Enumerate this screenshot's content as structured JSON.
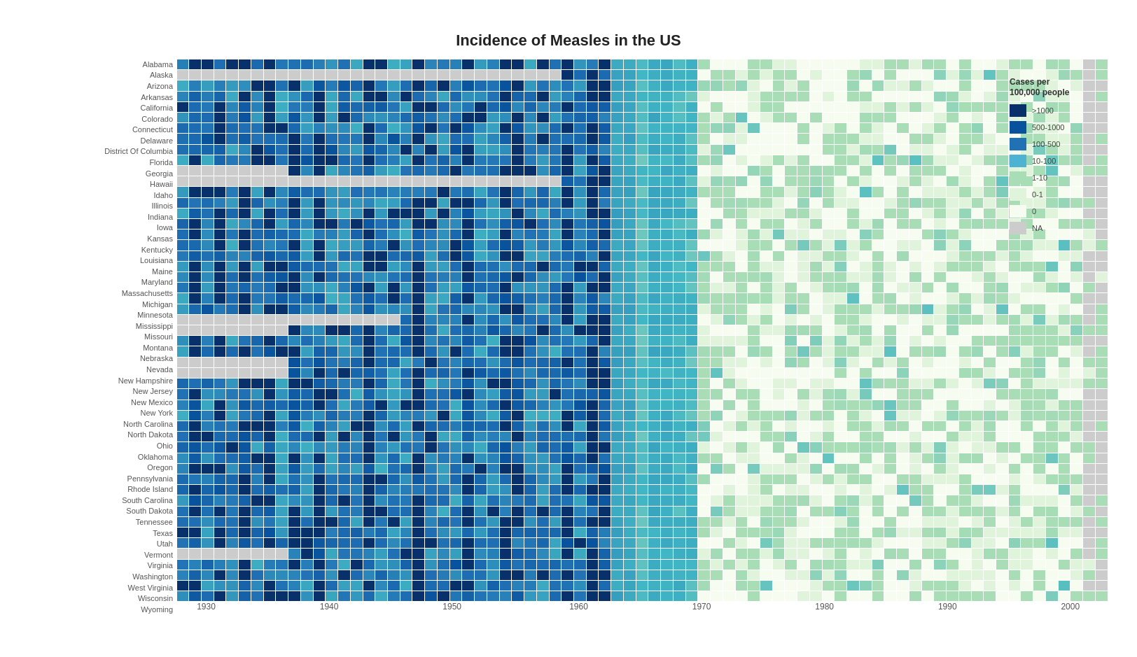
{
  "title": "Incidence of Measles in the US",
  "legend": {
    "title": "Cases per\n100,000 people",
    "items": [
      {
        "label": ">1000",
        "color": "#08306b"
      },
      {
        "label": "500-1000",
        "color": "#08519c"
      },
      {
        "label": "100-500",
        "color": "#2171b5"
      },
      {
        "label": "10-100",
        "color": "#4eb3d3"
      },
      {
        "label": "1-10",
        "color": "#a8ddb5"
      },
      {
        "label": "0-1",
        "color": "#e0f3db"
      },
      {
        "label": "0",
        "color": "#f7fcf0"
      },
      {
        "label": "NA",
        "color": "#cccccc"
      }
    ]
  },
  "states": [
    "Alabama",
    "Alaska",
    "Arizona",
    "Arkansas",
    "California",
    "Colorado",
    "Connecticut",
    "Delaware",
    "District Of Columbia",
    "Florida",
    "Georgia",
    "Hawaii",
    "Idaho",
    "Illinois",
    "Indiana",
    "Iowa",
    "Kansas",
    "Kentucky",
    "Louisiana",
    "Maine",
    "Maryland",
    "Massachusetts",
    "Michigan",
    "Minnesota",
    "Mississippi",
    "Missouri",
    "Montana",
    "Nebraska",
    "Nevada",
    "New Hampshire",
    "New Jersey",
    "New Mexico",
    "New York",
    "North Carolina",
    "North Dakota",
    "Ohio",
    "Oklahoma",
    "Oregon",
    "Pennsylvania",
    "Rhode Island",
    "South Carolina",
    "South Dakota",
    "Tennessee",
    "Texas",
    "Utah",
    "Vermont",
    "Virginia",
    "Washington",
    "West Virginia",
    "Wisconsin",
    "Wyoming"
  ],
  "years": [
    1928,
    1929,
    1930,
    1931,
    1932,
    1933,
    1934,
    1935,
    1936,
    1937,
    1938,
    1939,
    1940,
    1941,
    1942,
    1943,
    1944,
    1945,
    1946,
    1947,
    1948,
    1949,
    1950,
    1951,
    1952,
    1953,
    1954,
    1955,
    1956,
    1957,
    1958,
    1959,
    1960,
    1961,
    1962,
    1963,
    1964,
    1965,
    1966,
    1967,
    1968,
    1969,
    1970,
    1971,
    1972,
    1973,
    1974,
    1975,
    1976,
    1977,
    1978,
    1979,
    1980,
    1981,
    1982,
    1983,
    1984,
    1985,
    1986,
    1987,
    1988,
    1989,
    1990,
    1991,
    1992,
    1993,
    1994,
    1995,
    1996,
    1997,
    1998,
    1999,
    2000,
    2001,
    2002
  ],
  "x_ticks": [
    {
      "year": 1930,
      "pct": 3.2
    },
    {
      "year": 1940,
      "pct": 16.4
    },
    {
      "year": 1950,
      "pct": 29.6
    },
    {
      "year": 1960,
      "pct": 43.2
    },
    {
      "year": 1970,
      "pct": 56.4
    },
    {
      "year": 1980,
      "pct": 69.6
    },
    {
      "year": 1990,
      "pct": 82.8
    },
    {
      "year": 2000,
      "pct": 96.0
    }
  ],
  "accent_color": "#2171b5"
}
